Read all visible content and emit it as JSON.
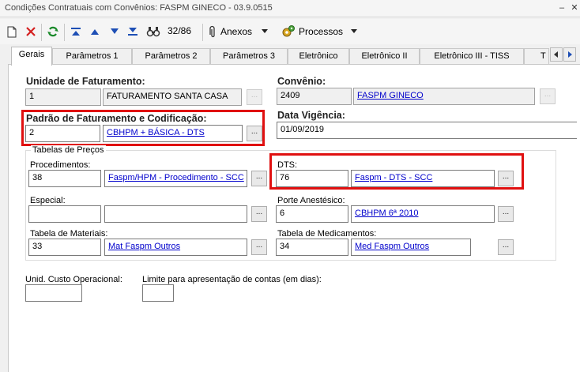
{
  "window": {
    "title": "Condições Contratuais com Convênios: FASPM GINECO - 03.9.0515"
  },
  "toolbar": {
    "record_counter": "32/86",
    "anexos_label": "Anexos",
    "processos_label": "Processos"
  },
  "tabs": [
    {
      "label": "Gerais"
    },
    {
      "label": "Parâmetros 1"
    },
    {
      "label": "Parâmetros 2"
    },
    {
      "label": "Parâmetros 3"
    },
    {
      "label": "Eletrônico"
    },
    {
      "label": "Eletrônico II"
    },
    {
      "label": "Eletrônico III - TISS"
    },
    {
      "label": "T"
    }
  ],
  "form": {
    "unidade": {
      "label": "Unidade de Faturamento:",
      "code": "1",
      "name": "FATURAMENTO SANTA CASA"
    },
    "convenio": {
      "label": "Convênio:",
      "code": "2409",
      "name": "FASPM GINECO"
    },
    "padrao": {
      "label": "Padrão de Faturamento e Codificação:",
      "code": "2",
      "name": "CBHPM + BÁSICA - DTS"
    },
    "vigencia": {
      "label": "Data Vigência:",
      "value": "01/09/2019"
    },
    "tabelas_precos": {
      "title": "Tabelas de Preços",
      "procedimentos": {
        "label": "Procedimentos:",
        "code": "38",
        "name": "Faspm/HPM - Procedimento - SCC"
      },
      "dts": {
        "label": "DTS:",
        "code": "76",
        "name": "Faspm - DTS - SCC"
      },
      "especial": {
        "label": "Especial:",
        "code": "",
        "name": ""
      },
      "porte": {
        "label": "Porte Anestésico:",
        "code": "6",
        "name": "CBHPM 6ª 2010"
      },
      "materiais": {
        "label": "Tabela de Materiais:",
        "code": "33",
        "name": "Mat Faspm Outros"
      },
      "medicamentos": {
        "label": "Tabela de Medicamentos:",
        "code": "34",
        "name": "Med Faspm Outros"
      }
    },
    "custo": {
      "label": "Unid. Custo Operacional:",
      "value": ""
    },
    "limite": {
      "label": "Limite para apresentação de contas (em dias):",
      "value": ""
    },
    "lookup_button": "..."
  }
}
